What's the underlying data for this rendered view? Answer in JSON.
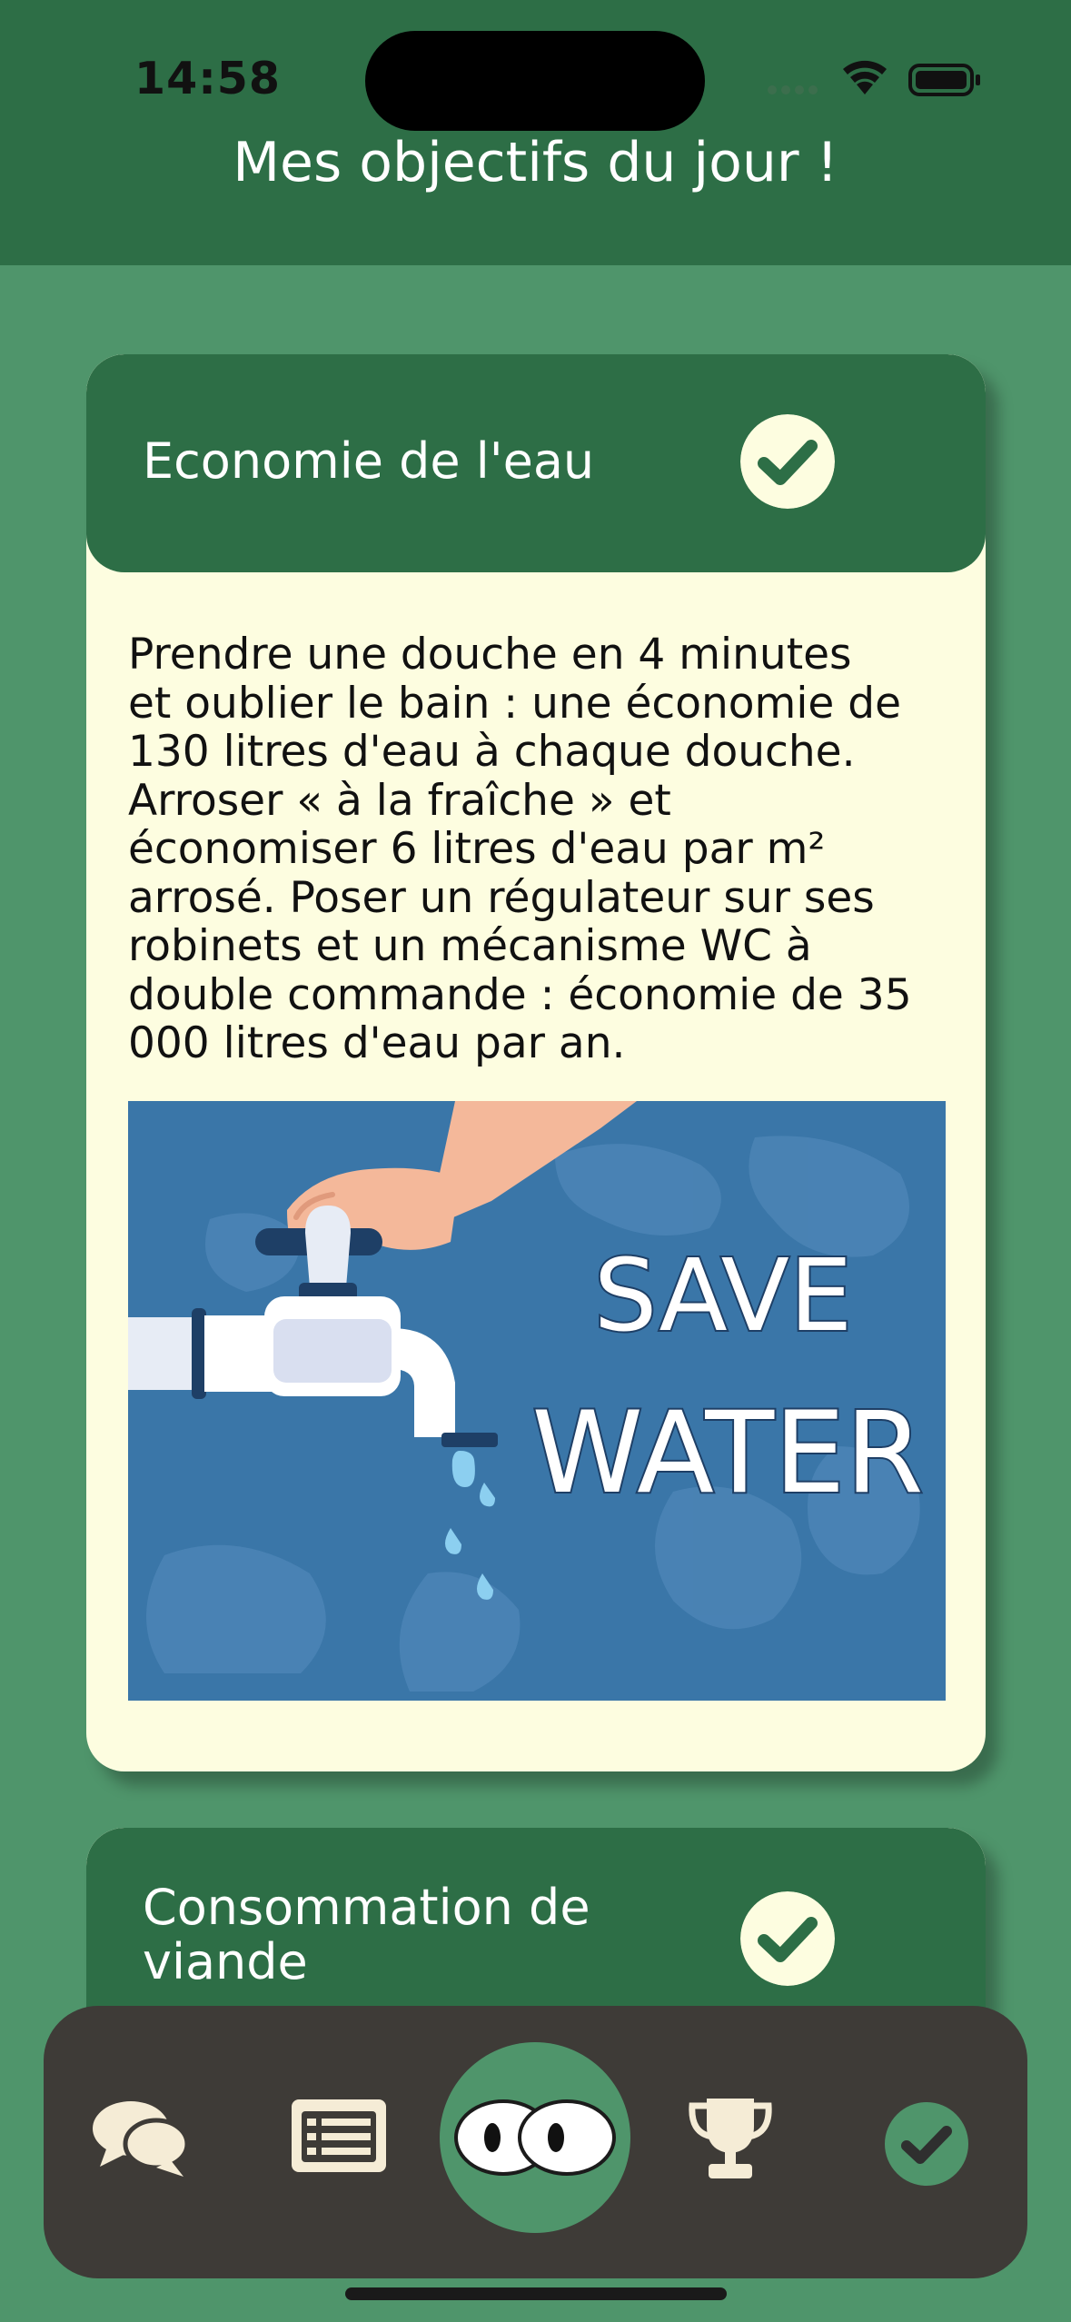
{
  "status_bar": {
    "time": "14:58"
  },
  "header": {
    "title": "Mes objectifs du jour !"
  },
  "cards": [
    {
      "title": "Economie de l'eau",
      "body_lines": [
        "Prendre une douche en 4 minutes",
        "et oublier le bain : une économie de",
        "130 litres d'eau à chaque douche.",
        "Arroser « à la fraîche » et",
        "économiser 6 litres d'eau par m²",
        "arrosé. Poser un régulateur sur ses",
        "robinets et un mécanisme WC à",
        "double commande : économie de 35",
        "000 litres d'eau par an."
      ],
      "image": {
        "line1": "SAVE",
        "line2": "WATER"
      },
      "completed": true
    },
    {
      "title_lines": [
        "Consommation de",
        "viande"
      ],
      "completed": true
    }
  ],
  "tabbar": {
    "items": [
      {
        "icon": "chat-bubbles-icon"
      },
      {
        "icon": "list-icon"
      },
      {
        "icon": "eyes-icon",
        "active": true
      },
      {
        "icon": "trophy-icon"
      },
      {
        "icon": "check-circle-icon"
      }
    ]
  },
  "colors": {
    "background": "#4f956b",
    "header": "#2d6e46",
    "card": "#fdfde0",
    "tabbar": "#3e3b37",
    "water_blue": "#3a76a8"
  }
}
